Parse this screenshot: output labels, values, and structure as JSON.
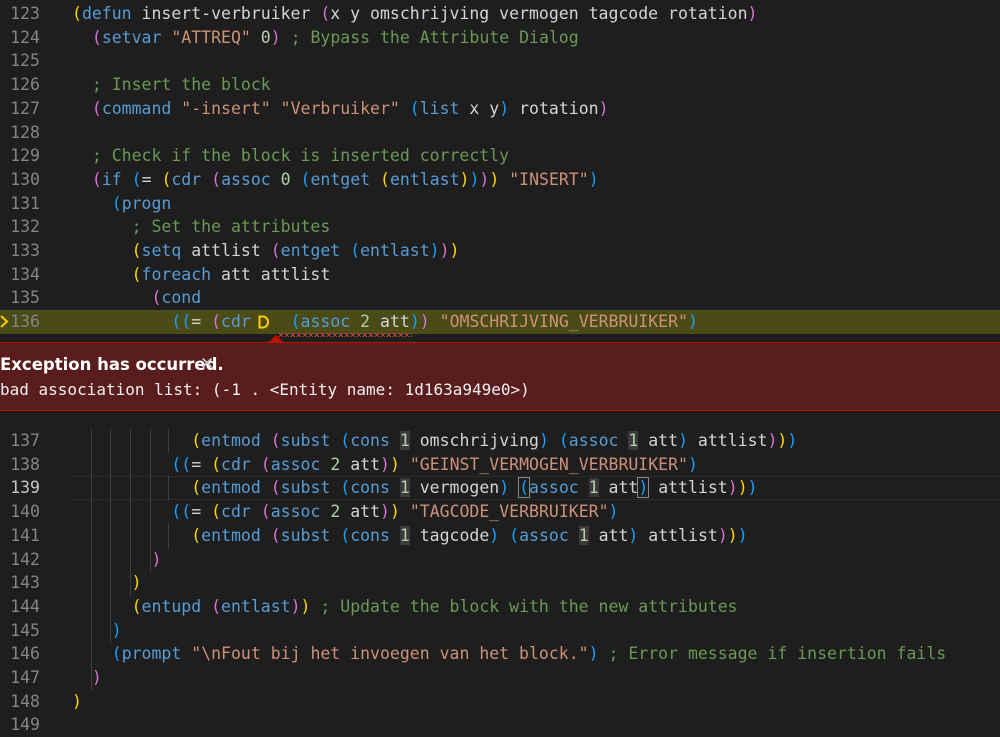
{
  "editor": {
    "lines": [
      {
        "n": "123",
        "html": "<span class='t-paren1'>(</span><span class='t-kw'>defun</span> insert-verbruiker <span class='t-paren2'>(</span>x y omschrijving vermogen tagcode rotation<span class='t-paren2'>)</span>"
      },
      {
        "n": "124",
        "html": "  <span class='t-paren2'>(</span><span class='t-kw'>setvar</span> <span class='t-str'>\"ATTREQ\"</span> <span class='t-num'>0</span><span class='t-paren2'>)</span> <span class='t-cmt'>; Bypass the Attribute Dialog</span>"
      },
      {
        "n": "125",
        "html": ""
      },
      {
        "n": "126",
        "html": "  <span class='t-cmt'>; Insert the block</span>"
      },
      {
        "n": "127",
        "html": "  <span class='t-paren2'>(</span><span class='t-kw'>command</span> <span class='t-str'>\"-insert\"</span> <span class='t-str'>\"Verbruiker\"</span> <span class='t-paren3'>(</span><span class='t-kw'>list</span> x y<span class='t-paren3'>)</span> rotation<span class='t-paren2'>)</span>"
      },
      {
        "n": "128",
        "html": ""
      },
      {
        "n": "129",
        "html": "  <span class='t-cmt'>; Check if the block is inserted correctly</span>"
      },
      {
        "n": "130",
        "html": "  <span class='t-paren2'>(</span><span class='t-kw'>if</span> <span class='t-paren3'>(</span>= <span class='t-paren1'>(</span><span class='t-kw'>cdr</span> <span class='t-paren2'>(</span><span class='t-kw'>assoc</span> <span class='t-num'>0</span> <span class='t-paren3'>(</span><span class='t-kw'>entget</span> <span class='t-paren1'>(</span><span class='t-kw'>entlast</span><span class='t-paren1'>)</span><span class='t-paren3'>)</span><span class='t-paren2'>)</span><span class='t-paren1'>)</span> <span class='t-str'>\"INSERT\"</span><span class='t-paren3'>)</span>"
      },
      {
        "n": "131",
        "html": "    <span class='t-paren3'>(</span><span class='t-kw'>progn</span>"
      },
      {
        "n": "132",
        "html": "      <span class='t-cmt'>; Set the attributes</span>"
      },
      {
        "n": "133",
        "html": "      <span class='t-paren1'>(</span><span class='t-kw'>setq</span> attlist <span class='t-paren2'>(</span><span class='t-kw'>entget</span> <span class='t-paren3'>(</span><span class='t-kw'>entlast</span><span class='t-paren3'>)</span><span class='t-paren2'>)</span><span class='t-paren1'>)</span>"
      },
      {
        "n": "134",
        "html": "      <span class='t-paren1'>(</span><span class='t-kw'>foreach</span> att attlist"
      },
      {
        "n": "135",
        "html": "        <span class='t-paren2'>(</span><span class='t-kw'>cond</span>"
      },
      {
        "n": "136",
        "html": "          <span class='t-paren3'>((</span>= <span class='t-paren2'>(</span><span class='t-kw'>cdr</span>    <span class='t-paren3'>(</span><span class='t-kw'>assoc</span> <span class='t-num'>2</span> att<span class='t-paren3'>)</span><span class='t-paren2'>)</span> <span class='t-str'>\"OMSCHRIJVING_VERBRUIKER\"</span><span class='t-paren3'>)</span>"
      },
      {
        "n": "137",
        "html": "            <span class='t-paren1'>(</span><span class='t-kw'>entmod</span> <span class='t-paren2'>(</span><span class='t-kw'>subst</span> <span class='t-paren3'>(</span><span class='t-kw'>cons</span> <span class='t-num numbox'>1</span> omschrijving<span class='t-paren3'>)</span> <span class='t-paren3'>(</span><span class='t-kw'>assoc</span> <span class='t-num numbox'>1</span> att<span class='t-paren3'>)</span> attlist<span class='t-paren2'>)</span><span class='t-paren1'>)</span><span class='t-paren3'>)</span>"
      },
      {
        "n": "138",
        "html": "          <span class='t-paren3'>((</span>= <span class='t-paren1'>(</span><span class='t-kw'>cdr</span> <span class='t-paren2'>(</span><span class='t-kw'>assoc</span> <span class='t-num'>2</span> att<span class='t-paren2'>)</span><span class='t-paren1'>)</span> <span class='t-str'>\"GEINST_VERMOGEN_VERBRUIKER\"</span><span class='t-paren3'>)</span>"
      },
      {
        "n": "139",
        "html": "            <span class='t-paren1'>(</span><span class='t-kw'>entmod</span> <span class='t-paren2'>(</span><span class='t-kw'>subst</span> <span class='t-paren3'>(</span><span class='t-kw'>cons</span> <span class='t-num numbox'>1</span> vermogen<span class='t-paren3'>)</span> <span class='t-paren3 brbox'>(</span><span class='t-kw'>assoc</span> <span class='t-num numbox'>1</span> att<span class='t-paren3 brbox'>)</span> attlist<span class='t-paren2'>)</span><span class='t-paren1'>)</span><span class='t-paren3'>)</span>"
      },
      {
        "n": "140",
        "html": "          <span class='t-paren3'>((</span>= <span class='t-paren1'>(</span><span class='t-kw'>cdr</span> <span class='t-paren2'>(</span><span class='t-kw'>assoc</span> <span class='t-num'>2</span> att<span class='t-paren2'>)</span><span class='t-paren1'>)</span> <span class='t-str'>\"TAGCODE_VERBRUIKER\"</span><span class='t-paren3'>)</span>"
      },
      {
        "n": "141",
        "html": "            <span class='t-paren1'>(</span><span class='t-kw'>entmod</span> <span class='t-paren2'>(</span><span class='t-kw'>subst</span> <span class='t-paren3'>(</span><span class='t-kw'>cons</span> <span class='t-num numbox'>1</span> tagcode<span class='t-paren3'>)</span> <span class='t-paren3'>(</span><span class='t-kw'>assoc</span> <span class='t-num numbox'>1</span> att<span class='t-paren3'>)</span> attlist<span class='t-paren2'>)</span><span class='t-paren1'>)</span><span class='t-paren3'>)</span>"
      },
      {
        "n": "142",
        "html": "        <span class='t-paren2'>)</span>"
      },
      {
        "n": "143",
        "html": "      <span class='t-paren1'>)</span>"
      },
      {
        "n": "144",
        "html": "      <span class='t-paren1'>(</span><span class='t-kw'>entupd</span> <span class='t-paren2'>(</span><span class='t-kw'>entlast</span><span class='t-paren2'>)</span><span class='t-paren1'>)</span> <span class='t-cmt'>; Update the block with the new attributes</span>"
      },
      {
        "n": "145",
        "html": "    <span class='t-paren3'>)</span>"
      },
      {
        "n": "146",
        "html": "    <span class='t-paren3'>(</span><span class='t-kw'>prompt</span> <span class='t-str'>\"\\nFout bij het invoegen van het block.\"</span><span class='t-paren3'>)</span> <span class='t-cmt'>; Error message if insertion fails</span>"
      },
      {
        "n": "147",
        "html": "  <span class='t-paren2'>)</span>"
      },
      {
        "n": "148",
        "html": "<span class='t-paren1'>)</span>"
      },
      {
        "n": "149",
        "html": ""
      }
    ],
    "current_line": "136",
    "cursor_line": "139"
  },
  "exception": {
    "title": "Exception has occurred.",
    "close_glyph": "✕",
    "message": "bad association list: (-1 . <Entity name: 1d163a949e0>)"
  }
}
